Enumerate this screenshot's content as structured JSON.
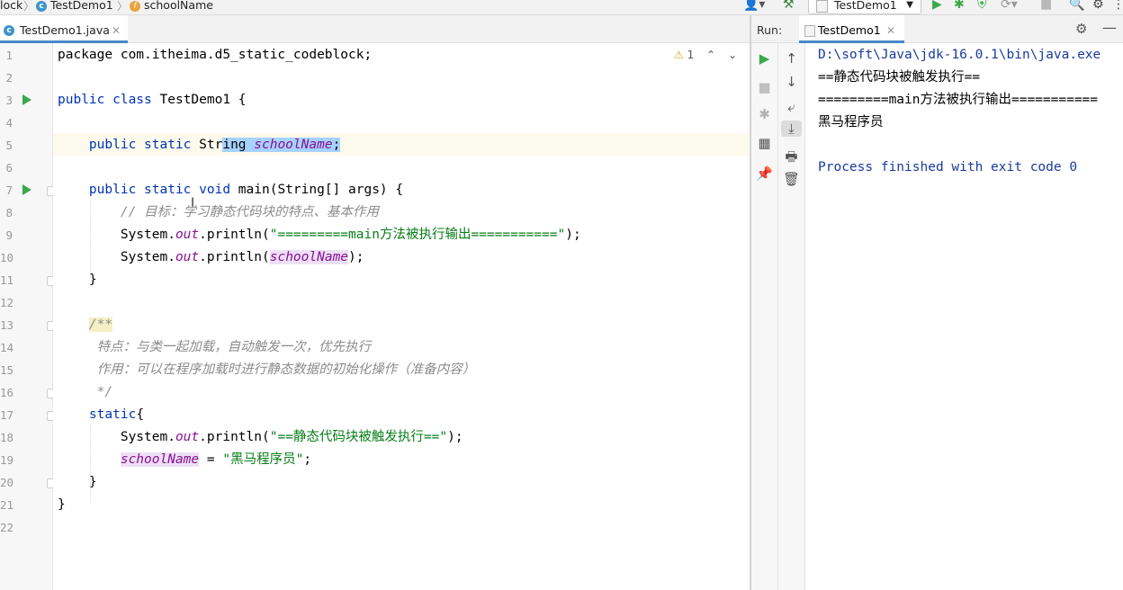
{
  "navbar": {
    "crumb_module": "lock",
    "crumb_class": "TestDemo1",
    "crumb_member": "schoolName",
    "run_config": "TestDemo1"
  },
  "editor": {
    "tab_label": "TestDemo1.java",
    "inspection_count": "1",
    "lines": [
      {
        "n": "1",
        "tokens": [
          {
            "t": "package com.itheima.d5_static_codeblock;",
            "c": ""
          }
        ]
      },
      {
        "n": "2",
        "tokens": []
      },
      {
        "n": "3",
        "tokens": [
          {
            "t": "public class ",
            "c": "kw"
          },
          {
            "t": "TestDemo1 {",
            "c": ""
          }
        ]
      },
      {
        "n": "4",
        "tokens": []
      },
      {
        "n": "5",
        "tokens": [
          {
            "t": "    public static ",
            "c": "kw"
          },
          {
            "t": "Str",
            "c": ""
          },
          {
            "t": "ing ",
            "c": "sel"
          },
          {
            "t": "schoolName",
            "c": "field sel"
          },
          {
            "t": ";",
            "c": "sel"
          }
        ]
      },
      {
        "n": "6",
        "tokens": []
      },
      {
        "n": "7",
        "tokens": [
          {
            "t": "    public static void ",
            "c": "kw"
          },
          {
            "t": "main(String[] args) {",
            "c": ""
          }
        ]
      },
      {
        "n": "8",
        "tokens": [
          {
            "t": "        // 目标：学习静态代码块的特点、基本作用",
            "c": "cmt"
          }
        ]
      },
      {
        "n": "9",
        "tokens": [
          {
            "t": "        System.",
            "c": ""
          },
          {
            "t": "out",
            "c": "field"
          },
          {
            "t": ".println(",
            "c": ""
          },
          {
            "t": "\"=========main方法被执行输出===========\"",
            "c": "str"
          },
          {
            "t": ");",
            "c": ""
          }
        ]
      },
      {
        "n": "10",
        "tokens": [
          {
            "t": "        System.",
            "c": ""
          },
          {
            "t": "out",
            "c": "field"
          },
          {
            "t": ".println(",
            "c": ""
          },
          {
            "t": "schoolName",
            "c": "field refbg"
          },
          {
            "t": ");",
            "c": ""
          }
        ]
      },
      {
        "n": "11",
        "tokens": [
          {
            "t": "    }",
            "c": ""
          }
        ]
      },
      {
        "n": "12",
        "tokens": []
      },
      {
        "n": "13",
        "tokens": [
          {
            "t": "    ",
            "c": ""
          },
          {
            "t": "/**",
            "c": "cmt docstart"
          }
        ]
      },
      {
        "n": "14",
        "tokens": [
          {
            "t": "     特点：与类一起加载，自动触发一次，优先执行",
            "c": "cmt"
          }
        ]
      },
      {
        "n": "15",
        "tokens": [
          {
            "t": "     作用：可以在程序加载时进行静态数据的初始化操作（准备内容）",
            "c": "cmt"
          }
        ]
      },
      {
        "n": "16",
        "tokens": [
          {
            "t": "     */",
            "c": "cmt"
          }
        ]
      },
      {
        "n": "17",
        "tokens": [
          {
            "t": "    static",
            "c": "kw"
          },
          {
            "t": "{",
            "c": ""
          }
        ]
      },
      {
        "n": "18",
        "tokens": [
          {
            "t": "        System.",
            "c": ""
          },
          {
            "t": "out",
            "c": "field"
          },
          {
            "t": ".println(",
            "c": ""
          },
          {
            "t": "\"==静态代码块被触发执行==\"",
            "c": "str"
          },
          {
            "t": ");",
            "c": ""
          }
        ]
      },
      {
        "n": "19",
        "tokens": [
          {
            "t": "        ",
            "c": ""
          },
          {
            "t": "schoolName",
            "c": "field refbg"
          },
          {
            "t": " = ",
            "c": ""
          },
          {
            "t": "\"黑马程序员\"",
            "c": "str"
          },
          {
            "t": ";",
            "c": ""
          }
        ]
      },
      {
        "n": "20",
        "tokens": [
          {
            "t": "    }",
            "c": ""
          }
        ]
      },
      {
        "n": "21",
        "tokens": [
          {
            "t": "}",
            "c": ""
          }
        ]
      },
      {
        "n": "22",
        "tokens": []
      }
    ]
  },
  "run": {
    "label": "Run:",
    "tab_label": "TestDemo1",
    "console": [
      {
        "text": "D:\\soft\\Java\\jdk-16.0.1\\bin\\java.exe",
        "color": "#1a3a9e"
      },
      {
        "text": "==静态代码块被触发执行==",
        "color": "#000000"
      },
      {
        "text": "=========main方法被执行输出===========",
        "color": "#000000"
      },
      {
        "text": "黑马程序员",
        "color": "#000000"
      },
      {
        "text": "",
        "color": "#000000"
      },
      {
        "text": "Process finished with exit code 0",
        "color": "#1a3a9e"
      }
    ]
  },
  "icons": {
    "warning": "warning-icon",
    "run": "run-icon",
    "debug": "debug-icon",
    "settings": "gear-icon"
  }
}
